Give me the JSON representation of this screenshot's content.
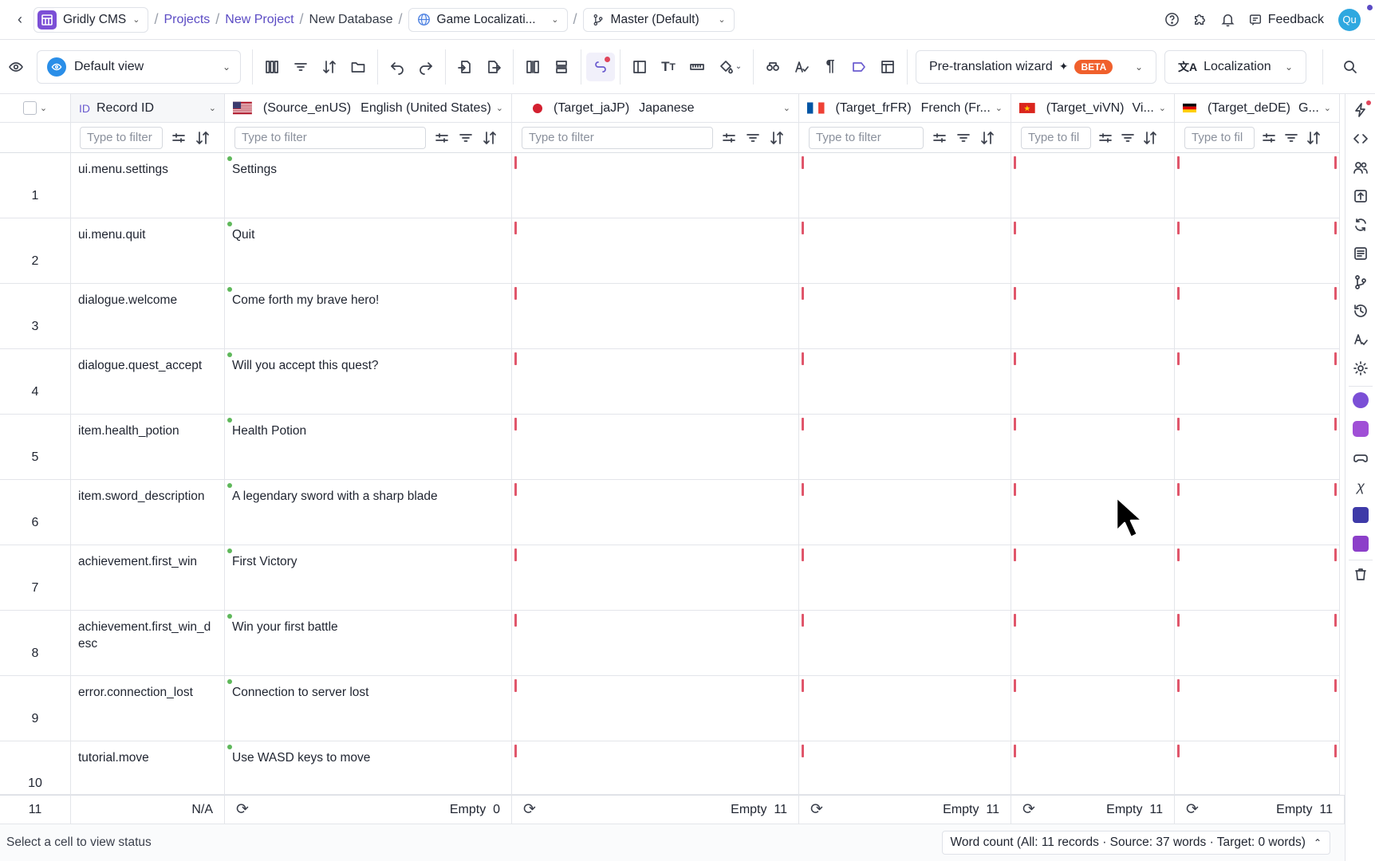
{
  "topbar": {
    "app_name": "Gridly CMS",
    "breadcrumbs": [
      "Projects",
      "New Project",
      "New Database"
    ],
    "grid_name": "Game Localizati...",
    "branch": "Master (Default)",
    "feedback": "Feedback",
    "avatar": "Qu"
  },
  "toolbar": {
    "view": "Default view",
    "pretranslate": "Pre-translation wizard",
    "beta": "BETA",
    "localization": "Localization"
  },
  "columns": [
    {
      "id_tag": "ID",
      "label": "Record ID"
    },
    {
      "tag": "(Source_enUS)",
      "label": "English (United States)"
    },
    {
      "tag": "(Target_jaJP)",
      "label": "Japanese"
    },
    {
      "tag": "(Target_frFR)",
      "label": "French (Fr..."
    },
    {
      "tag": "(Target_viVN)",
      "label": "Vi..."
    },
    {
      "tag": "(Target_deDE)",
      "label": "G..."
    }
  ],
  "filters": {
    "full": "Type to filter",
    "short": "Type to fil"
  },
  "rows": [
    {
      "num": "1",
      "id": "ui.menu.settings",
      "en": "Settings"
    },
    {
      "num": "2",
      "id": "ui.menu.quit",
      "en": "Quit"
    },
    {
      "num": "3",
      "id": "dialogue.welcome",
      "en": "Come forth my brave hero!"
    },
    {
      "num": "4",
      "id": "dialogue.quest_accept",
      "en": "Will you accept this quest?"
    },
    {
      "num": "5",
      "id": "item.health_potion",
      "en": "Health Potion"
    },
    {
      "num": "6",
      "id": "item.sword_description",
      "en": "A legendary sword with a sharp blade"
    },
    {
      "num": "7",
      "id": "achievement.first_win",
      "en": "First Victory"
    },
    {
      "num": "8",
      "id": "achievement.first_win_desc",
      "en": "Win your first battle"
    },
    {
      "num": "9",
      "id": "error.connection_lost",
      "en": "Connection to server lost"
    },
    {
      "num": "10",
      "id": "tutorial.move",
      "en": "Use WASD keys to move"
    }
  ],
  "footer": {
    "row_num": "11",
    "id_value": "N/A",
    "empty_label": "Empty",
    "source_empty": "0",
    "target_empty": "11"
  },
  "status": {
    "left": "Select a cell to view status",
    "word_count": "Word count (All: 11 records · Source: 37 words · Target: 0 words)"
  }
}
